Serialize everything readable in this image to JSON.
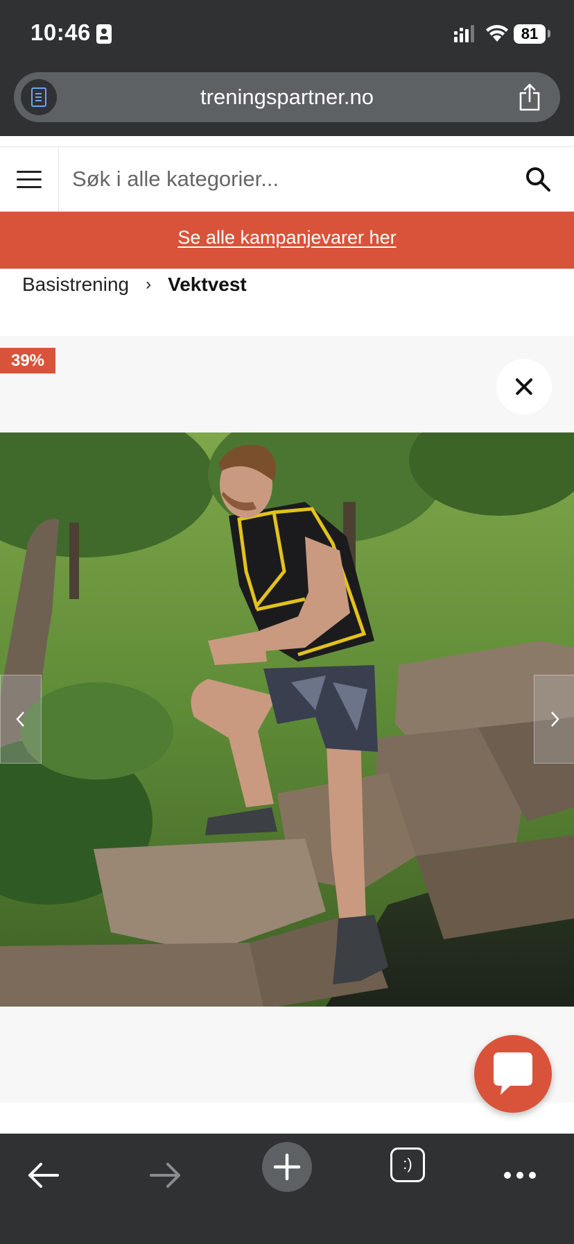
{
  "status_bar": {
    "time": "10:46",
    "battery": "81",
    "icons": [
      "id-card-icon",
      "signal-icon",
      "wifi-icon",
      "battery-icon"
    ]
  },
  "browser": {
    "url": "treningspartner.no",
    "reader_icon": "reader-mode-icon",
    "share_icon": "share-icon",
    "toolbar_icons": [
      "back-arrow-icon",
      "forward-arrow-icon",
      "plus-icon",
      "tabs-icon",
      "more-icon"
    ],
    "tabs_label": ":)"
  },
  "header": {
    "menu_icon": "hamburger-icon",
    "search_placeholder": "Søk i alle kategorier...",
    "search_value": "",
    "search_icon": "search-icon"
  },
  "promo": {
    "link_text": "Se alle kampanjevarer her",
    "color": "#d9533a"
  },
  "breadcrumb": {
    "items": [
      "Basistrening",
      "Vektvest"
    ],
    "separator": "›"
  },
  "product": {
    "discount_badge": "39%",
    "close_icon": "close-icon",
    "image": "product-photo",
    "prev_icon": "chevron-left-icon",
    "next_icon": "chevron-right-icon"
  },
  "chat": {
    "icon": "chat-bubble-icon",
    "color": "#d9533a"
  }
}
